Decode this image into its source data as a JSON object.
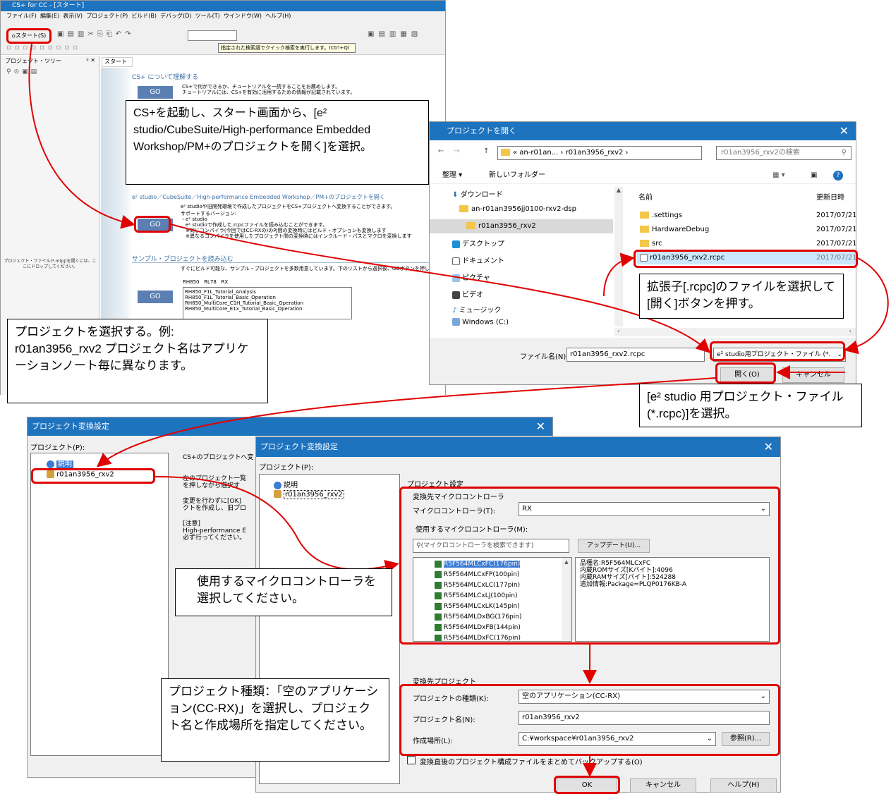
{
  "csplus": {
    "title": "CS+ for CC - [スタート]",
    "menus": [
      "ファイル(F)",
      "編集(E)",
      "表示(V)",
      "プロジェクト(P)",
      "ビルド(B)",
      "デバッグ(D)",
      "ツール(T)",
      "ウインドウ(W)",
      "ヘルプ(H)"
    ],
    "start_button": "スタート(S)",
    "search_tooltip": "指定された検索語でクイック検索を実行します。(Ctrl+Q)",
    "tree_title": "プロジェクト・ツリー",
    "tab_start": "スタート",
    "tree_hint": "プロジェクト・ファイル(*.mtpj)を開くには、ここにドロップしてください。",
    "go_label": "GO",
    "section1_title": "CS+ について理解する",
    "section1_text": "CS+で何ができるか、チュートリアルを一読することをお薦めします。",
    "section1_text2": "チュートリアルには、CS+を有効に活用するための情報が記載されています。",
    "section2_title": "e² studio／CubeSuite／High-performance Embedded Workshop／PM+のプロジェクトを開く",
    "section2_text": "e² studioや旧開発環境で作成したプロジェクトをCS+プロジェクトへ変換することができます。",
    "section2_supported": "サポートするバージョン:",
    "section2_list": [
      "・e² studio",
      "e² studioで作成した.rcpcファイルを読み込むことができます。",
      "※同じコンパイラ(今回ではCC-RXの)のPJ間の変換時にはビルド・オプションも変換します",
      "※異なるコンパイラを使用したプロジェクト間の変換時にはインクルード・パスとマクロを変換します"
    ],
    "section3_title": "サンプル・プロジェクトを読み込む",
    "section3_text": "すぐにビルド可能な、サンプル・プロジェクトを多数用意しています。下のリストから選択後、GOボタンを押してください。",
    "sample_tabs": [
      "RH850",
      "RL78",
      "RX"
    ],
    "samples": [
      "RH850_F1L_Tutorial_Analysis",
      "RH850_F1L_Tutorial_Basic_Operation",
      "RH850_MultiCore_C1H_Tutorial_Basic_Operation",
      "RH850_MultiCore_E1x_Tutorial_Basic_Operation"
    ]
  },
  "open_dialog": {
    "title": "プロジェクトを開く",
    "breadcrumb": [
      "« an-r01an...",
      "r01an3956_rxv2"
    ],
    "search_placeholder": "r01an3956_rxv2の検索",
    "organize": "整理 ▾",
    "new_folder": "新しいフォルダー",
    "nav": [
      "ダウンロード",
      "an-r01an3956jj0100-rxv2-dsp",
      "r01an3956_rxv2",
      "デスクトップ",
      "ドキュメント",
      "ピクチャ",
      "ビデオ",
      "ミュージック",
      "Windows (C:)"
    ],
    "col_name": "名前",
    "col_date": "更新日時",
    "files": [
      {
        "name": ".settings",
        "date": "2017/07/21"
      },
      {
        "name": "HardwareDebug",
        "date": "2017/07/21"
      },
      {
        "name": "src",
        "date": "2017/07/21"
      },
      {
        "name": "r01an3956_rxv2.rcpc",
        "date": "2017/07/21"
      }
    ],
    "filename_label": "ファイル名(N):",
    "filename_value": "r01an3956_rxv2.rcpc",
    "filetype": "e² studio用プロジェクト・ファイル (*.",
    "open_button": "開く(O)",
    "cancel_button": "キャンセル"
  },
  "conv_back": {
    "title": "プロジェクト変換設定",
    "project_label": "プロジェクト(P):",
    "tree": [
      "説明",
      "r01an3956_rxv2"
    ],
    "desc_lines": [
      "CS+のプロジェクトへ変",
      "左のプロジェクト一覧",
      "を押しながら選択す",
      "変更を行わずに[OK]",
      "クトを作成し、旧プロ",
      "[注意]",
      "High-performance E",
      "必ず行ってください。"
    ]
  },
  "conv_front": {
    "title": "プロジェクト変換設定",
    "project_label": "プロジェクト(P):",
    "tree": [
      "説明",
      "r01an3956_rxv2"
    ],
    "settings_label": "プロジェクト設定",
    "mcu_group": "変換先マイクロコントローラ",
    "mcu_label": "マイクロコントローラ(T):",
    "mcu_value": "RX",
    "use_mcu_label": "使用するマイクロコントローラ(M):",
    "mcu_search_placeholder": "(マイクロコントローラを検索できます)",
    "update_button": "アップデート(U)...",
    "devices": [
      "R5F564MLCxFC(176pin)",
      "R5F564MLCxFP(100pin)",
      "R5F564MLCxLC(177pin)",
      "R5F564MLCxLJ(100pin)",
      "R5F564MLCxLK(145pin)",
      "R5F564MLDxBG(176pin)",
      "R5F564MLDxFB(144pin)",
      "R5F564MLDxFC(176pin)"
    ],
    "device_info": [
      "品種名:R5F564MLCxFC",
      "内蔵ROMサイズ[Kバイト]:4096",
      "内蔵RAMサイズ[バイト]:524288",
      "追加情報:Package=PLQP0176KB-A"
    ],
    "proj_group": "変換先プロジェクト",
    "type_label": "プロジェクトの種類(K):",
    "type_value": "空のアプリケーション(CC-RX)",
    "name_label": "プロジェクト名(N):",
    "name_value": "r01an3956_rxv2",
    "loc_label": "作成場所(L):",
    "loc_value": "C:¥workspace¥r01an3956_rxv2",
    "browse_button": "参照(R)...",
    "backup_label": "変換直後のプロジェクト構成ファイルをまとめてバックアップする(O)",
    "ok_button": "OK",
    "cancel_button": "キャンセル",
    "help_button": "ヘルプ(H)"
  },
  "notes": {
    "note1": "CS+を起動し、スタート画面から、[e² studio/CubeSuite/High-performance Embedded Workshop/PM+のプロジェクトを開く]を選択。",
    "note2": "拡張子[.rcpc]のファイルを選択して[開く]ボタンを押す。",
    "note3": "プロジェクトを選択する。例: r01an3956_rxv2 プロジェクト名はアプリケーションノート毎に異なります。",
    "note4": "[e² studio 用プロジェクト・ファイル(*.rcpc)]を選択。",
    "note5": "使用するマイクロコントローラを選択してください。",
    "note6": "プロジェクト種類：「空のアプリケーション(CC-RX)」を選択し、プロジェクト名と作成場所を指定してください。"
  },
  "colors": {
    "annotation": "#e00000",
    "titlebar": "#1e73be",
    "go_button": "#5b7fb3",
    "selection": "#cce8ff"
  }
}
